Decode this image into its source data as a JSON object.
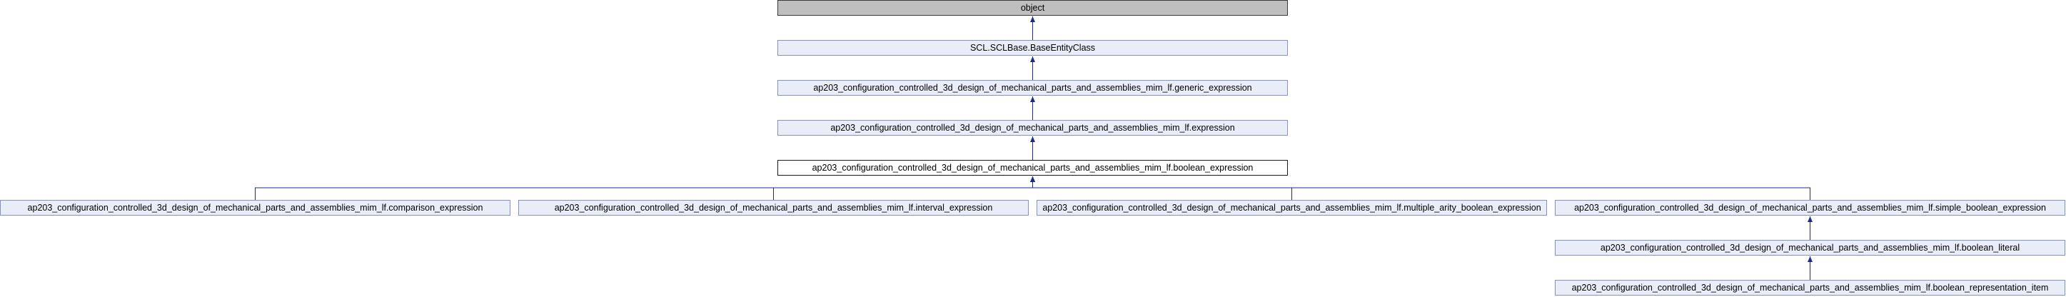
{
  "diagram": {
    "nodes": {
      "object": "object",
      "base_entity": "SCL.SCLBase.BaseEntityClass",
      "generic_expression": "ap203_configuration_controlled_3d_design_of_mechanical_parts_and_assemblies_mim_lf.generic_expression",
      "expression": "ap203_configuration_controlled_3d_design_of_mechanical_parts_and_assemblies_mim_lf.expression",
      "boolean_expression": "ap203_configuration_controlled_3d_design_of_mechanical_parts_and_assemblies_mim_lf.boolean_expression",
      "comparison_expression": "ap203_configuration_controlled_3d_design_of_mechanical_parts_and_assemblies_mim_lf.comparison_expression",
      "interval_expression": "ap203_configuration_controlled_3d_design_of_mechanical_parts_and_assemblies_mim_lf.interval_expression",
      "multiple_arity_boolean_expression": "ap203_configuration_controlled_3d_design_of_mechanical_parts_and_assemblies_mim_lf.multiple_arity_boolean_expression",
      "simple_boolean_expression": "ap203_configuration_controlled_3d_design_of_mechanical_parts_and_assemblies_mim_lf.simple_boolean_expression",
      "boolean_literal": "ap203_configuration_controlled_3d_design_of_mechanical_parts_and_assemblies_mim_lf.boolean_literal",
      "boolean_representation_item": "ap203_configuration_controlled_3d_design_of_mechanical_parts_and_assemblies_mim_lf.boolean_representation_item"
    },
    "edges": [
      {
        "from": "base_entity",
        "to": "object"
      },
      {
        "from": "generic_expression",
        "to": "base_entity"
      },
      {
        "from": "expression",
        "to": "generic_expression"
      },
      {
        "from": "boolean_expression",
        "to": "expression"
      },
      {
        "from": "comparison_expression",
        "to": "boolean_expression"
      },
      {
        "from": "interval_expression",
        "to": "boolean_expression"
      },
      {
        "from": "multiple_arity_boolean_expression",
        "to": "boolean_expression"
      },
      {
        "from": "simple_boolean_expression",
        "to": "boolean_expression"
      },
      {
        "from": "boolean_literal",
        "to": "simple_boolean_expression"
      },
      {
        "from": "boolean_representation_item",
        "to": "boolean_literal"
      }
    ],
    "colors": {
      "edge": "#1c2a8c",
      "node_fill": "#e8edf7",
      "node_border": "#8491c4",
      "root_fill": "#bfbfbf",
      "current_fill": "#ffffff"
    }
  }
}
